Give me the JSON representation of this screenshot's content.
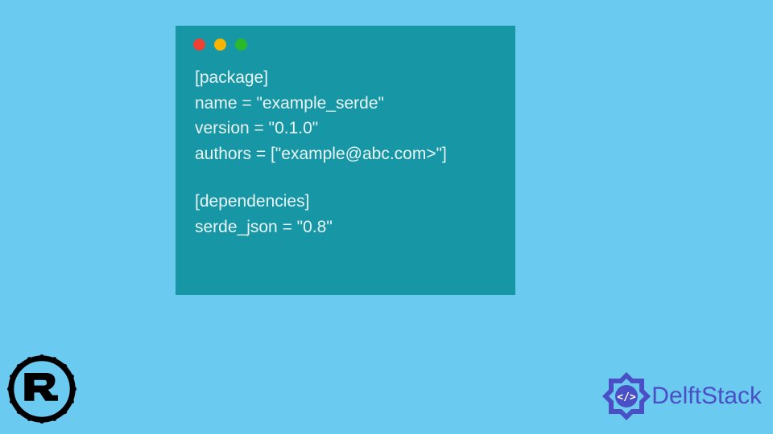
{
  "code": {
    "lines": [
      "[package]",
      "name = \"example_serde\"",
      "version = \"0.1.0\"",
      "authors = [\"example@abc.com>\"]",
      "",
      "[dependencies]",
      "serde_json = \"0.8\""
    ]
  },
  "branding": {
    "delft_text": "DelftStack"
  },
  "colors": {
    "background": "#6acaf0",
    "window": "#1797a6",
    "code_text": "#e8f4f6",
    "delft_blue": "#4a4fc5"
  }
}
